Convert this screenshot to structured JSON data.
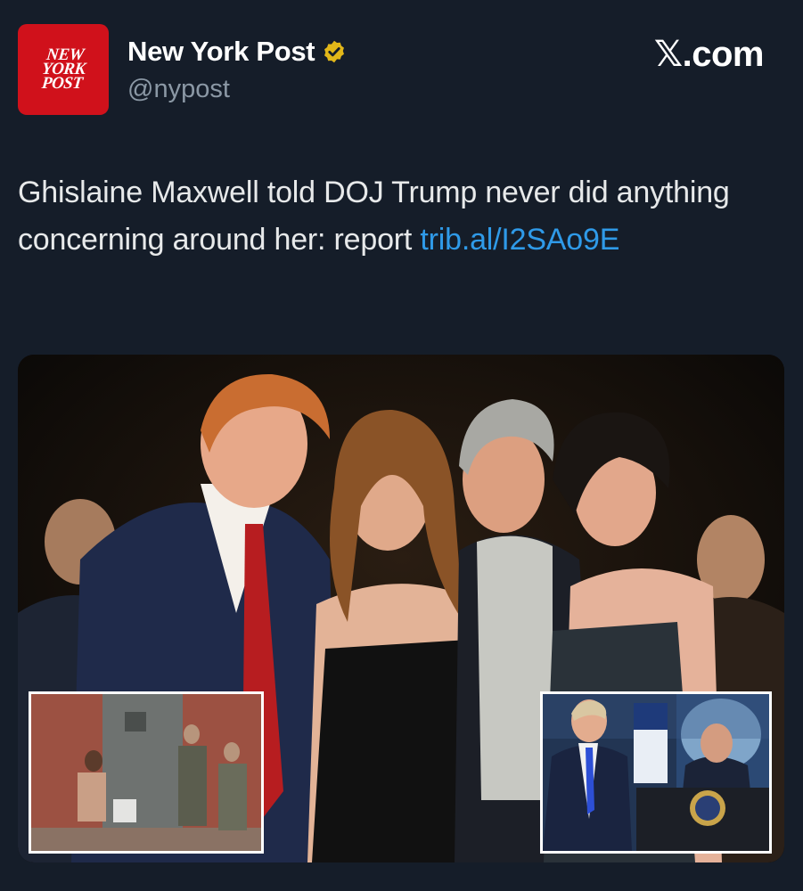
{
  "account": {
    "avatar_text": [
      "NEW",
      "YORK",
      "POST"
    ],
    "display_name": "New York Post",
    "handle": "@nypost",
    "verified": true,
    "verified_color": "#e2b719"
  },
  "brand": {
    "label": "𝕏.com"
  },
  "tweet": {
    "text": "Ghislaine Maxwell told DOJ Trump never did anything concerning around her: report ",
    "link": "trib.al/I2SAo9E"
  },
  "colors": {
    "background": "#151d29",
    "link": "#2f9ae8",
    "avatar_red": "#d0111b"
  }
}
